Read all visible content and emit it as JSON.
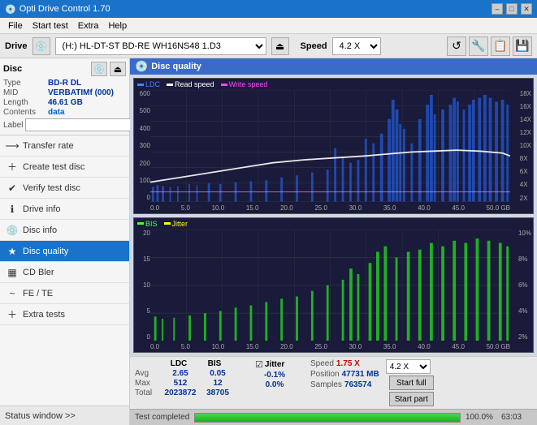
{
  "titlebar": {
    "title": "Opti Drive Control 1.70",
    "minimize": "–",
    "maximize": "□",
    "close": "✕"
  },
  "menu": {
    "items": [
      "File",
      "Start test",
      "Extra",
      "Help"
    ]
  },
  "drive_bar": {
    "drive_label": "Drive",
    "drive_value": "(H:) HL-DT-ST BD-RE  WH16NS48 1.D3",
    "speed_label": "Speed",
    "speed_value": "4.2 X"
  },
  "disc_panel": {
    "title": "Disc",
    "type_label": "Type",
    "type_value": "BD-R DL",
    "mid_label": "MID",
    "mid_value": "VERBATIMf (000)",
    "length_label": "Length",
    "length_value": "46.61 GB",
    "contents_label": "Contents",
    "contents_value": "data",
    "label_label": "Label",
    "label_value": ""
  },
  "sidebar": {
    "items": [
      {
        "id": "transfer-rate",
        "label": "Transfer rate",
        "icon": "⟶"
      },
      {
        "id": "create-test-disc",
        "label": "Create test disc",
        "icon": "+"
      },
      {
        "id": "verify-test-disc",
        "label": "Verify test disc",
        "icon": "✔"
      },
      {
        "id": "drive-info",
        "label": "Drive info",
        "icon": "ℹ"
      },
      {
        "id": "disc-info",
        "label": "Disc info",
        "icon": "💿"
      },
      {
        "id": "disc-quality",
        "label": "Disc quality",
        "icon": "★",
        "active": true
      },
      {
        "id": "cd-bler",
        "label": "CD Bler",
        "icon": "▦"
      },
      {
        "id": "fe-te",
        "label": "FE / TE",
        "icon": "~"
      },
      {
        "id": "extra-tests",
        "label": "Extra tests",
        "icon": "+"
      }
    ],
    "status_window": "Status window >>"
  },
  "disc_quality": {
    "title": "Disc quality",
    "chart1": {
      "legend": [
        {
          "label": "LDC",
          "color": "#4488ff"
        },
        {
          "label": "Read speed",
          "color": "#ffffff"
        },
        {
          "label": "Write speed",
          "color": "#ff44ff"
        }
      ],
      "y_left": [
        "600",
        "500",
        "400",
        "300",
        "200",
        "100",
        "0"
      ],
      "y_right": [
        "18X",
        "16X",
        "14X",
        "12X",
        "10X",
        "8X",
        "6X",
        "4X",
        "2X"
      ],
      "x_axis": [
        "0.0",
        "5.0",
        "10.0",
        "15.0",
        "20.0",
        "25.0",
        "30.0",
        "35.0",
        "40.0",
        "45.0",
        "50.0 GB"
      ]
    },
    "chart2": {
      "legend": [
        {
          "label": "BIS",
          "color": "#44ff44"
        },
        {
          "label": "Jitter",
          "color": "#ffff00"
        }
      ],
      "y_left": [
        "20",
        "15",
        "10",
        "5",
        "0"
      ],
      "y_right": [
        "10%",
        "8%",
        "6%",
        "4%",
        "2%"
      ],
      "x_axis": [
        "0.0",
        "5.0",
        "10.0",
        "15.0",
        "20.0",
        "25.0",
        "30.0",
        "35.0",
        "40.0",
        "45.0",
        "50.0 GB"
      ]
    },
    "stats": {
      "ldc_label": "LDC",
      "bis_label": "BIS",
      "jitter_label": "Jitter",
      "jitter_checked": true,
      "speed_label": "Speed",
      "speed_value": "1.75 X",
      "speed_select": "4.2 X",
      "avg_label": "Avg",
      "avg_ldc": "2.65",
      "avg_bis": "0.05",
      "avg_jitter": "-0.1%",
      "max_label": "Max",
      "max_ldc": "512",
      "max_bis": "12",
      "max_jitter": "0.0%",
      "total_label": "Total",
      "total_ldc": "2023872",
      "total_bis": "38705",
      "position_label": "Position",
      "position_value": "47731 MB",
      "samples_label": "Samples",
      "samples_value": "763574",
      "start_full": "Start full",
      "start_part": "Start part"
    },
    "progress": {
      "status": "Test completed",
      "percent": "100.0%",
      "percent_num": 100,
      "time": "63:03"
    }
  }
}
